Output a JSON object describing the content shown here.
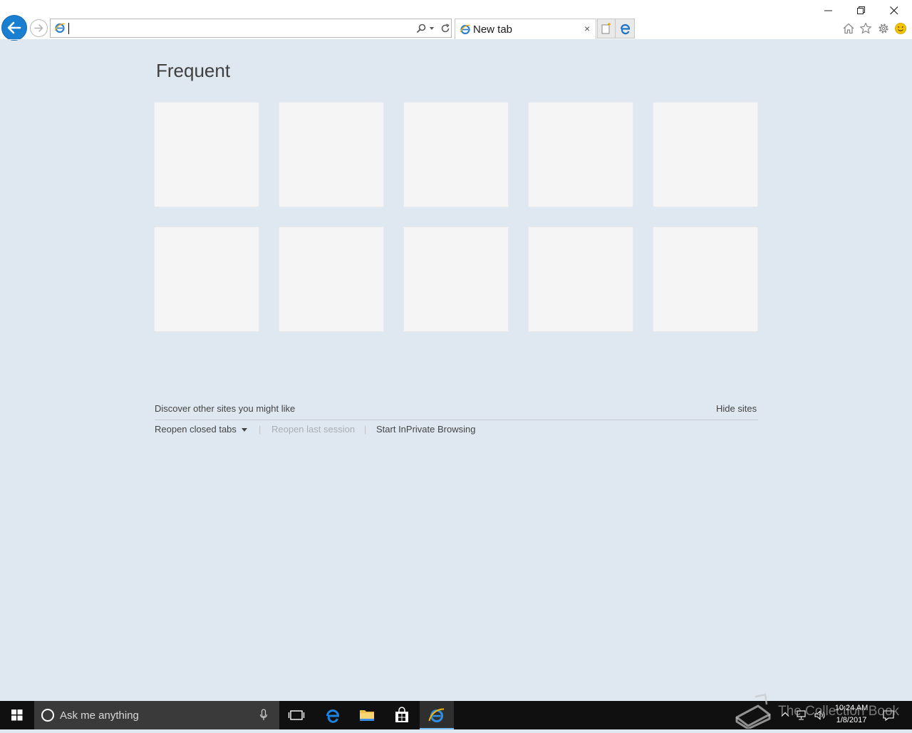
{
  "address_bar": {
    "value": ""
  },
  "tab": {
    "label": "New tab",
    "close_glyph": "×"
  },
  "content": {
    "heading": "Frequent",
    "tile_count": 10,
    "discover_text": "Discover other sites you might like",
    "hide_sites_label": "Hide sites",
    "reopen_closed_tabs_label": "Reopen closed tabs",
    "reopen_last_session_label": "Reopen last session",
    "inprivate_label": "Start InPrivate Browsing",
    "separator": "|"
  },
  "taskbar": {
    "search_placeholder": "Ask me anything",
    "clock_time": "10:24 AM",
    "clock_date": "1/8/2017",
    "pinned_icons": [
      "task-view-icon",
      "edge-icon",
      "file-explorer-icon",
      "store-icon",
      "internet-explorer-icon"
    ]
  },
  "watermark": {
    "text": "The Collection Book"
  },
  "colors": {
    "page_background": "#dfe8f0",
    "tile_background": "#f5f5f5",
    "back_button": "#1a7fd0",
    "taskbar": "#101010",
    "active_taskbar_accent": "#76b9ed"
  }
}
